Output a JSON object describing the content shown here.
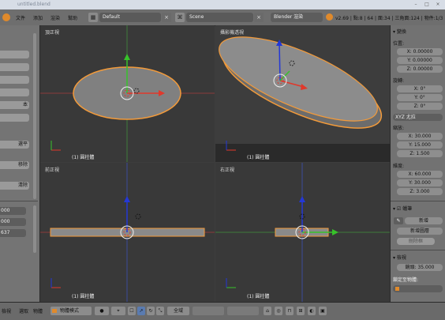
{
  "window": {
    "title": "untitled.blend",
    "controls": [
      "–",
      "□",
      "×"
    ]
  },
  "menubar": {
    "menus": [
      "文件",
      "添加",
      "渲染",
      "幫助"
    ],
    "screen_layout": "Default",
    "scene": "Scene",
    "render_engine": "Blender 渲染",
    "stats": "v2.69 | 點:8 | 64 | 面:34 | 三角面:124 | 物件:1/3"
  },
  "left_toolbar": {
    "buttons": [
      "本",
      "選平",
      "移除",
      "清除"
    ],
    "fields": [
      "000",
      "000",
      "637"
    ]
  },
  "viewports": [
    {
      "name": "頂正視",
      "object_label": "(1) 圓柱體"
    },
    {
      "name": "攝影機透視",
      "object_label": "(1) 圓柱體"
    },
    {
      "name": "前正視",
      "object_label": "(1) 圓柱體"
    },
    {
      "name": "右正視",
      "object_label": "(1) 圓柱體"
    }
  ],
  "right_panel": {
    "transform_header": "變換",
    "location_label": "位置:",
    "location": [
      "X: 0.00000",
      "Y: 0.00000",
      "Z: 0.00000"
    ],
    "rotation_label": "旋轉:",
    "rotation": [
      "X: 0°",
      "Y: 0°",
      "Z: 0°"
    ],
    "rotation_mode": "XYZ 尤拉",
    "scale_label": "縮放:",
    "scale": [
      "X: 30.000",
      "Y: 15.000",
      "Z: 1.500"
    ],
    "dimensions_label": "維度:",
    "dimensions": [
      "X: 60.000",
      "Y: 30.000",
      "Z: 3.000"
    ],
    "grease_header": "蠟筆",
    "grease_new": "新增",
    "grease_new_layer": "新增圖層",
    "grease_delete_frame": "刪除框",
    "view_header": "檢視",
    "view_lens": "鏡頭: 35.000",
    "lock_to_object": "鎖定至物體:"
  },
  "bottombar": {
    "items": [
      "檢視",
      "選取",
      "物體"
    ],
    "mode": "物體模式",
    "pivot": "全域"
  },
  "colors": {
    "viewport_bg": "#393939",
    "selection_outline": "#f29a3a",
    "axis_x": "#e0382b",
    "axis_y": "#37c22a",
    "axis_z": "#2438d6",
    "grid_red": "#8a3b3b",
    "grid_green": "#3f7a3a",
    "grid_blue": "#3b4b9c",
    "object_grey": "#808080"
  }
}
